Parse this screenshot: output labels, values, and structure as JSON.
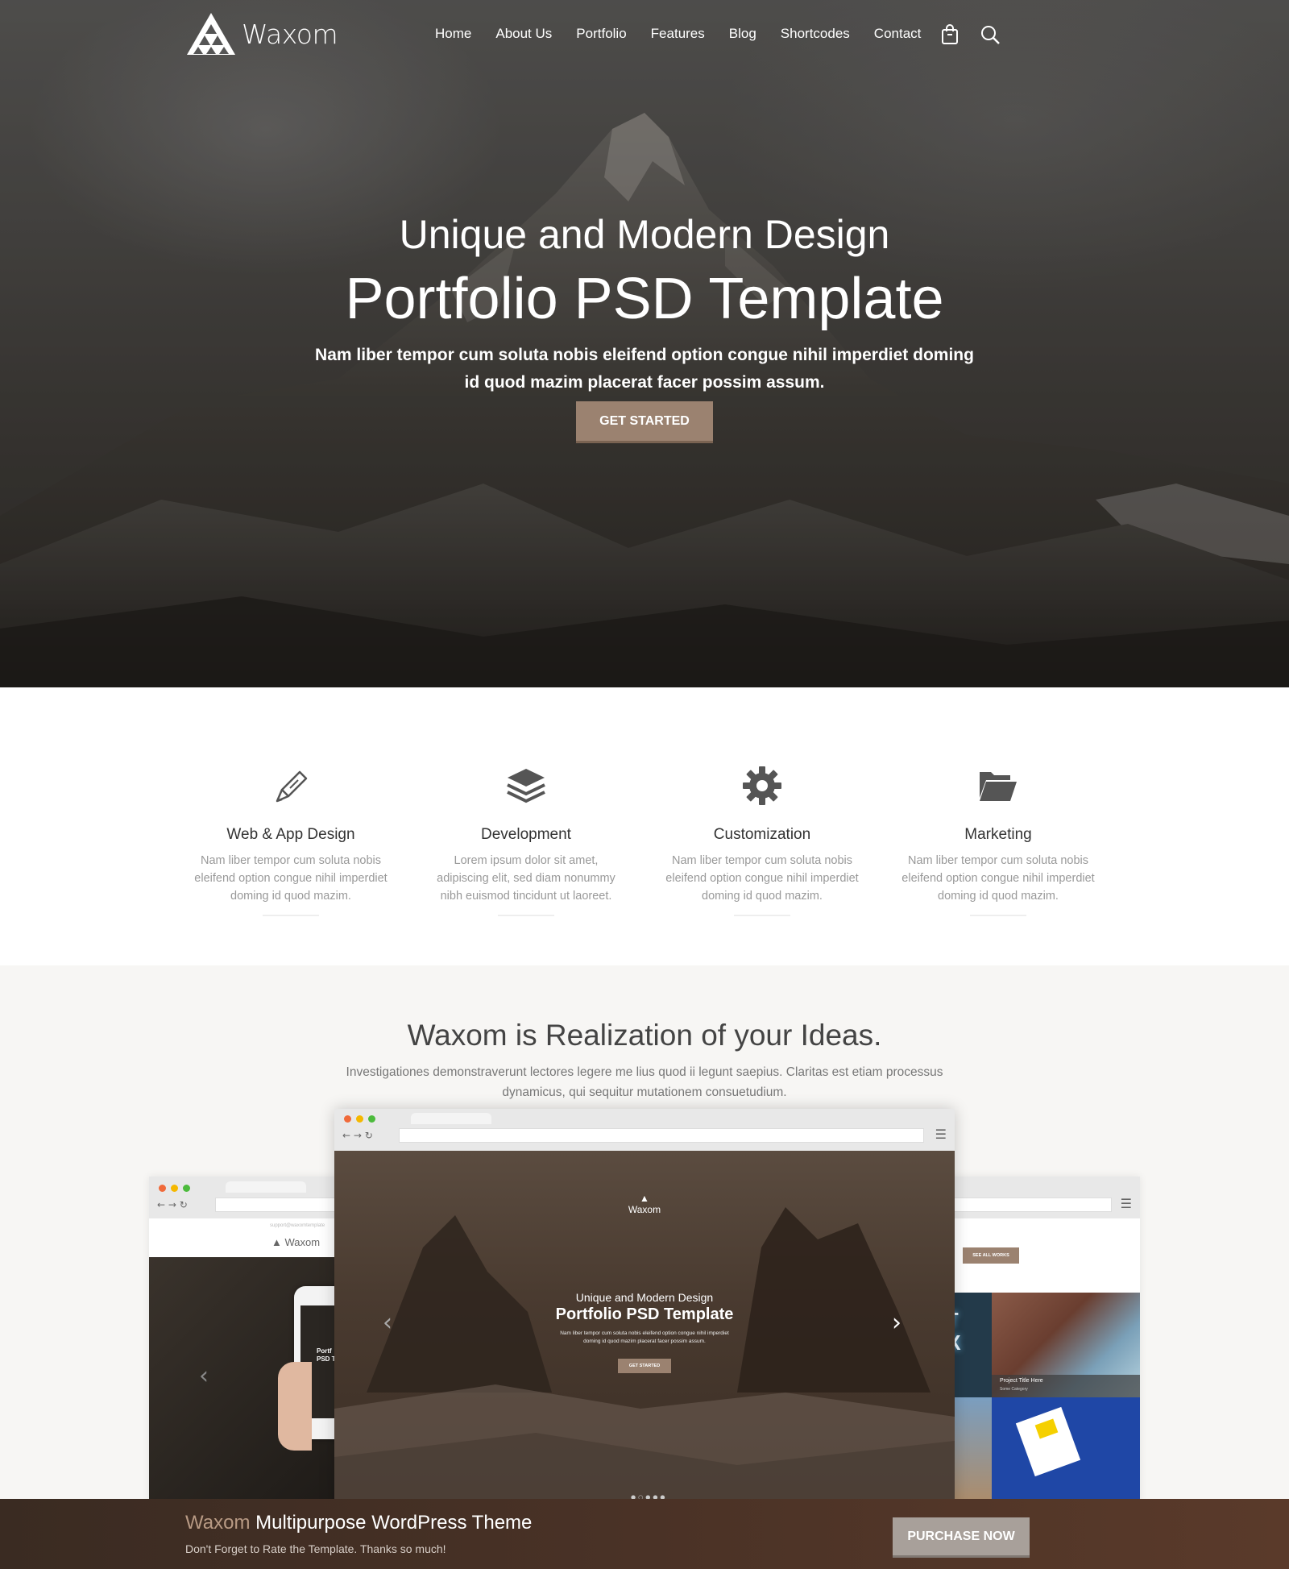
{
  "header": {
    "logo_text": "Waxom",
    "nav": [
      "Home",
      "About Us",
      "Portfolio",
      "Features",
      "Blog",
      "Shortcodes",
      "Contact"
    ],
    "icons": [
      "shopping-bag-icon",
      "search-icon"
    ]
  },
  "hero": {
    "subtitle": "Unique and Modern Design",
    "title": "Portfolio PSD Template",
    "text": "Nam liber tempor cum soluta nobis eleifend option congue nihil imperdiet doming id quod mazim placerat facer possim assum.",
    "button": "GET STARTED"
  },
  "features": [
    {
      "title": "Web & App Design",
      "desc": "Nam liber tempor cum soluta nobis eleifend option congue nihil imperdiet doming id quod mazim.",
      "icon": "pen-icon"
    },
    {
      "title": "Development",
      "desc": "Lorem ipsum dolor sit amet, adipiscing elit, sed diam nonummy nibh euismod tincidunt ut laoreet.",
      "icon": "layers-icon"
    },
    {
      "title": "Customization",
      "desc": "Nam liber tempor cum soluta nobis eleifend option congue nihil imperdiet doming id quod mazim.",
      "icon": "gear-icon"
    },
    {
      "title": "Marketing",
      "desc": "Nam liber tempor cum soluta nobis eleifend option congue nihil imperdiet doming id quod mazim.",
      "icon": "folder-icon"
    }
  ],
  "realization": {
    "title": "Waxom is Realization of your Ideas.",
    "text": "Investigationes demonstraverunt lectores legere me lius quod ii legunt saepius. Claritas est etiam processus dynamicus, qui sequitur mutationem consuetudium."
  },
  "mockup": {
    "center": {
      "logo": "Waxom",
      "subtitle": "Unique and Modern Design",
      "title": "Portfolio PSD Template",
      "text": "Nam liber tempor cum soluta nobis eleifend option congue nihil imperdiet doming id quod mazim placerat facer possim assum.",
      "button": "GET STARTED"
    },
    "left": {
      "logo": "Waxom",
      "email": "support@waxomtemplate",
      "phone_text_1": "Portf",
      "phone_text_2": "PSD Tem"
    },
    "right": {
      "button": "SEE ALL WORKS",
      "project_title": "Project Title Here",
      "project_cat": "Some Category",
      "sign_text": "HT OX"
    }
  },
  "bottom_bar": {
    "brand": "Waxom",
    "title_rest": " Multipurpose WordPress Theme",
    "subtitle": "Don't Forget to Rate the Template. Thanks so much!",
    "button": "PURCHASE NOW"
  },
  "colors": {
    "accent": "#9b8270",
    "bottom_bar": "#4a3226",
    "section_bg": "#f7f6f4"
  }
}
